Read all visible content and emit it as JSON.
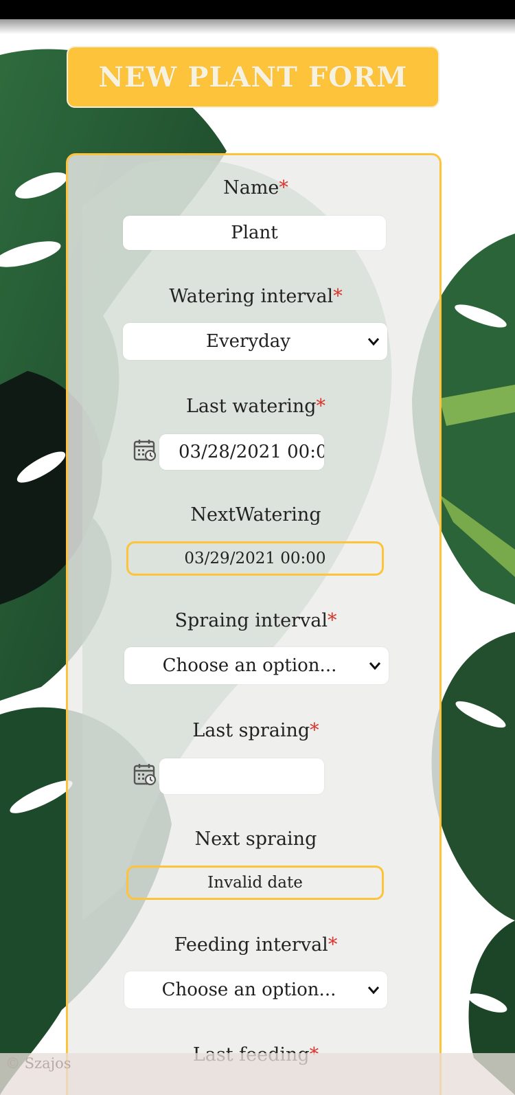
{
  "app": {
    "title": "NEW PLANT FORM",
    "footer_text": "© Szajos"
  },
  "form": {
    "name": {
      "label": "Name",
      "required_mark": "*",
      "value": "Plant"
    },
    "watering_interval": {
      "label": "Watering interval",
      "required_mark": "*",
      "value": "Everyday",
      "icon": "chevron-down-icon"
    },
    "last_watering": {
      "label": "Last watering",
      "required_mark": "*",
      "value": "03/28/2021 00:0",
      "icon": "calendar-icon"
    },
    "next_watering": {
      "label": "NextWatering",
      "value": "03/29/2021 00:00"
    },
    "spraying_interval": {
      "label": "Spraing interval",
      "required_mark": "*",
      "value": "Choose an option...",
      "icon": "chevron-down-icon"
    },
    "last_spraying": {
      "label": "Last spraing",
      "required_mark": "*",
      "value": "",
      "icon": "calendar-icon"
    },
    "next_spraying": {
      "label": "Next spraing",
      "value": "Invalid date"
    },
    "feeding_interval": {
      "label": "Feeding interval",
      "required_mark": "*",
      "value": "Choose an option...",
      "icon": "chevron-down-icon"
    },
    "last_feeding": {
      "label": "Last feeding",
      "required_mark": "*"
    }
  },
  "colors": {
    "accent": "#fdc33a",
    "required": "#d9342b",
    "leaf_dark": "#1f4f2e",
    "leaf_mid": "#2f6b3e"
  }
}
